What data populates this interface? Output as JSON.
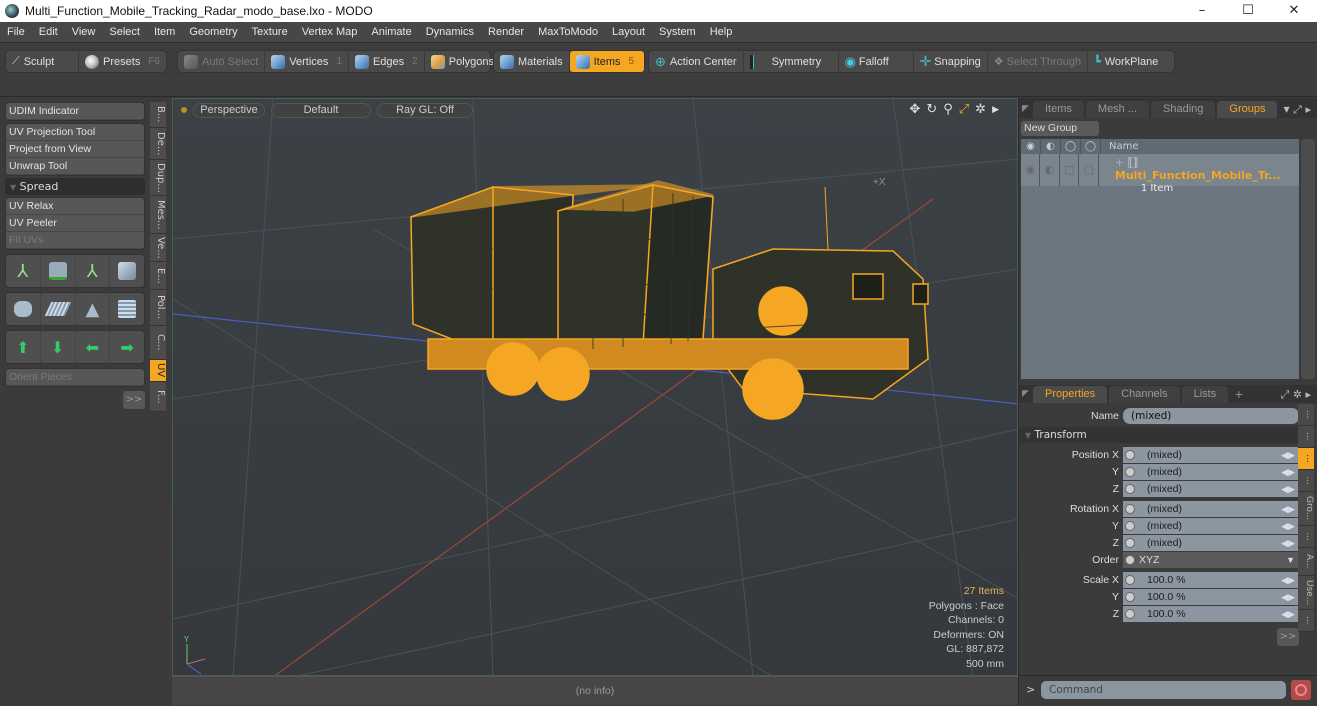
{
  "window": {
    "title": "Multi_Function_Mobile_Tracking_Radar_modo_base.lxo - MODO",
    "minimize": "–",
    "maximize": "☐",
    "close": "✕"
  },
  "menu": [
    "File",
    "Edit",
    "View",
    "Select",
    "Item",
    "Geometry",
    "Texture",
    "Vertex Map",
    "Animate",
    "Dynamics",
    "Render",
    "MaxToModo",
    "Layout",
    "System",
    "Help"
  ],
  "toolbar": {
    "sculpt": "Sculpt",
    "presets": "Presets",
    "presets_key": "F6",
    "auto_select": "Auto Select",
    "vertices": "Vertices",
    "vertices_key": "1",
    "edges": "Edges",
    "edges_key": "2",
    "polygons": "Polygons",
    "materials": "Materials",
    "items": "Items",
    "items_key": "5",
    "action_center": "Action Center",
    "symmetry": "Symmetry",
    "falloff": "Falloff",
    "snapping": "Snapping",
    "select_through": "Select Through",
    "workplane": "WorkPlane"
  },
  "left_panel": {
    "udim": "UDIM Indicator",
    "tools": [
      "UV Projection Tool",
      "Project from View",
      "Unwrap Tool"
    ],
    "spread": "Spread",
    "tools2": [
      "UV Relax",
      "UV Peeler",
      "Fit UVs"
    ],
    "orient": "Orient Pieces",
    "more": ">>",
    "vtabs": [
      "B...",
      "De...",
      "Dup...",
      "Mes...",
      "Ve...",
      "E...",
      "Pol...",
      "C...",
      "UV",
      "F..."
    ],
    "active_vtab": "UV"
  },
  "viewport": {
    "view": "Perspective",
    "shading": "Default",
    "raygl": "Ray GL: Off",
    "axis_label": "+X",
    "info": {
      "items": "27 Items",
      "polygons": "Polygons : Face",
      "channels": "Channels: 0",
      "deformers": "Deformers: ON",
      "gl": "GL: 887,872",
      "scale": "500 mm"
    },
    "status": "(no info)",
    "wire_color": "#f5a623"
  },
  "groups_panel": {
    "tabs": [
      "Items",
      "Mesh ...",
      "Shading",
      "Groups"
    ],
    "active_tab": "Groups",
    "new_group": "New Group",
    "column_name": "Name",
    "rows": [
      {
        "name": "Multi_Function_Mobile_Tr...",
        "sub": "1 Item"
      }
    ]
  },
  "properties_panel": {
    "tabs": [
      "Properties",
      "Channels",
      "Lists",
      "+"
    ],
    "active_tab": "Properties",
    "name_label": "Name",
    "name_value": "(mixed)",
    "section": "Transform",
    "position": {
      "label": "Position X",
      "x": "(mixed)",
      "y": "(mixed)",
      "z": "(mixed)"
    },
    "rotation": {
      "label": "Rotation X",
      "x": "(mixed)",
      "y": "(mixed)",
      "z": "(mixed)"
    },
    "order": {
      "label": "Order",
      "value": "XYZ"
    },
    "scale": {
      "label": "Scale X",
      "x": "100.0 %",
      "y": "100.0 %",
      "z": "100.0 %"
    },
    "y_label": "Y",
    "z_label": "Z",
    "more": ">>",
    "vtabs": [
      "...",
      "...",
      "...",
      "...",
      "Gro...",
      "...",
      "A...",
      "Use...",
      "..."
    ]
  },
  "command": {
    "prompt": ">",
    "placeholder": "Command"
  }
}
